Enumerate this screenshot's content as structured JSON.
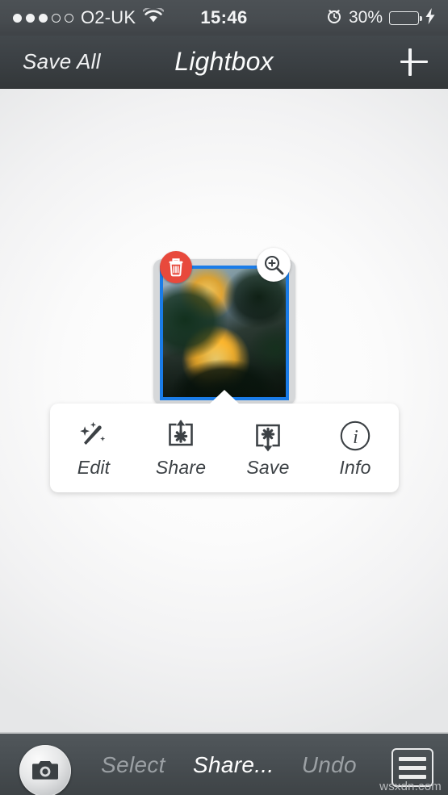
{
  "status_bar": {
    "signal": {
      "filled_dots": 3,
      "empty_dots": 2,
      "icon": "signal-dots-icon"
    },
    "carrier": "O2-UK",
    "wifi_icon": "wifi-icon",
    "time": "15:46",
    "alarm_icon": "alarm-clock-icon",
    "battery_percent": "30%",
    "battery_level": 30,
    "battery_icon": "battery-icon",
    "charging_icon": "lightning-bolt-icon",
    "colors": {
      "background": "#474c50",
      "text": "#f2f3f4",
      "battery_fill": "#4cd455"
    }
  },
  "navbar": {
    "left_button": "Save All",
    "title": "Lightbox",
    "add_button_icon": "plus-icon",
    "colors": {
      "background": "#3b4044",
      "text": "#fbfcfc"
    }
  },
  "thumbnail": {
    "delete_badge_icon": "trash-icon",
    "zoom_badge_icon": "magnifier-plus-icon",
    "selected": true,
    "photo_description": "yellow rose",
    "colors": {
      "card": "#d6d8da",
      "selection_border": "#1a7ce8",
      "delete_badge": "#e8493c"
    }
  },
  "popover": {
    "items": [
      {
        "label": "Edit",
        "icon": "magic-wand-icon"
      },
      {
        "label": "Share",
        "icon": "share-box-up-arrow-icon"
      },
      {
        "label": "Save",
        "icon": "save-box-down-arrow-icon"
      },
      {
        "label": "Info",
        "icon": "info-circle-icon"
      }
    ],
    "colors": {
      "background": "#ffffff",
      "label": "#3c4145"
    }
  },
  "toolbar": {
    "camera_button_icon": "camera-icon",
    "items": [
      {
        "label": "Select",
        "state": "disabled"
      },
      {
        "label": "Share...",
        "state": "active"
      },
      {
        "label": "Undo",
        "state": "disabled"
      }
    ],
    "menu_button_icon": "hamburger-menu-icon",
    "colors": {
      "background": "#494f53",
      "active_text": "#ffffff",
      "disabled_text": "#9ba0a4"
    }
  },
  "watermark": "wsxdn.com"
}
